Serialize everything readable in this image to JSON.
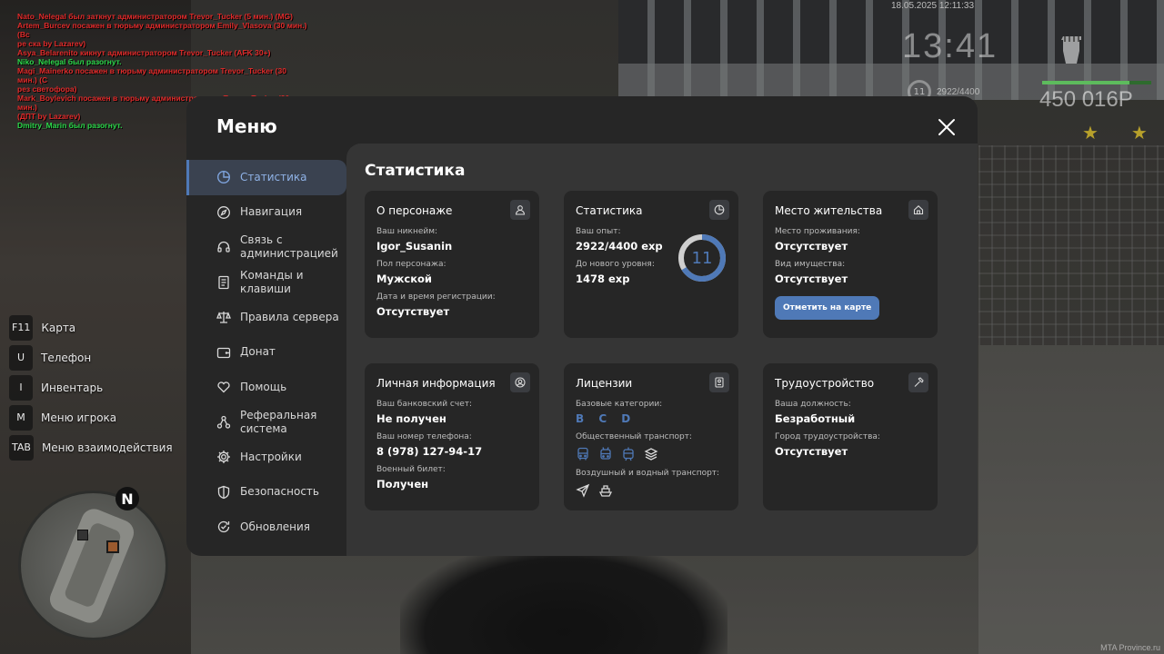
{
  "chat": [
    {
      "text": "Nato_Nelegal был заткнут администратором Trevor_Tucker (5 мин.) (MG)",
      "color": "red"
    },
    {
      "text": "Artem_Burcev посажен в тюрьму администратором Emily_Vlasova (30 мин.) (Вс",
      "color": "red"
    },
    {
      "text": "ре ска by Lazarev)",
      "color": "red"
    },
    {
      "text": "Asya_Belarenito кикнут администратором Trevor_Tucker (AFK 30+)",
      "color": "red"
    },
    {
      "text": "Niko_Nelegal был разогнут.",
      "color": "green"
    },
    {
      "text": "Magi_Mainerko посажен в тюрьму администратором Trevor_Tucker (30 мин.) (С",
      "color": "red"
    },
    {
      "text": "рез светофора)",
      "color": "red"
    },
    {
      "text": "Mark_Boylevich посажен в тюрьму администратором Trevor_Tucker (30 мин.)",
      "color": "red"
    },
    {
      "text": "(ДПТ by Lazarev)",
      "color": "red"
    },
    {
      "text": "Dmitry_Marin был разогнут.",
      "color": "green"
    }
  ],
  "hud": {
    "datetime": "18.05.2025 12:11:33",
    "clock": "13:41",
    "level": "11",
    "exp": "2922/4400",
    "money": "450 016Р",
    "health_fraction": 0.8,
    "stars": "★★"
  },
  "hotkeys": [
    {
      "key": "F11",
      "label": "Карта"
    },
    {
      "key": "U",
      "label": "Телефон"
    },
    {
      "key": "I",
      "label": "Инвентарь"
    },
    {
      "key": "M",
      "label": "Меню игрока"
    },
    {
      "key": "TAB",
      "label": "Меню взаимодействия"
    }
  ],
  "minimap": {
    "north": "N"
  },
  "watermark": "MTA Province.ru",
  "menu": {
    "title": "Меню",
    "sidebar": [
      {
        "label": "Статистика",
        "icon": "pie-chart-icon"
      },
      {
        "label": "Навигация",
        "icon": "compass-icon"
      },
      {
        "label": "Связь с администрацией",
        "icon": "headset-icon"
      },
      {
        "label": "Команды и клавиши",
        "icon": "document-icon"
      },
      {
        "label": "Правила сервера",
        "icon": "scales-icon"
      },
      {
        "label": "Донат",
        "icon": "wallet-icon"
      },
      {
        "label": "Помощь",
        "icon": "heart-hand-icon"
      },
      {
        "label": "Реферальная система",
        "icon": "network-icon"
      },
      {
        "label": "Настройки",
        "icon": "gear-icon"
      },
      {
        "label": "Безопасность",
        "icon": "shield-icon"
      },
      {
        "label": "Обновления",
        "icon": "refresh-check-icon"
      }
    ],
    "content_title": "Статистика",
    "cards": {
      "persona": {
        "title": "О персонаже",
        "nickname_label": "Ваш никнейм:",
        "nickname": "Igor_Susanin",
        "gender_label": "Пол персонажа:",
        "gender": "Мужской",
        "reg_label": "Дата и время регистрации:",
        "reg": "Отсутствует"
      },
      "stats": {
        "title": "Статистика",
        "exp_label": "Ваш опыт:",
        "exp": "2922/4400 exp",
        "next_label": "До нового уровня:",
        "next": "1478 exp",
        "level": "11",
        "progress_fraction": 0.664
      },
      "residence": {
        "title": "Место жительства",
        "place_label": "Место проживания:",
        "place": "Отсутствует",
        "property_label": "Вид имущества:",
        "property": "Отсутствует",
        "button": "Отметить на карте"
      },
      "personal": {
        "title": "Личная информация",
        "bank_label": "Ваш банковский счет:",
        "bank": "Не получен",
        "phone_label": "Ваш номер телефона:",
        "phone": "8 (978) 127-94-17",
        "military_label": "Военный билет:",
        "military": "Получен"
      },
      "licenses": {
        "title": "Лицензии",
        "base_label": "Базовые категории:",
        "base": "B C D",
        "public_label": "Общественный транспорт:",
        "air_label": "Воздушный и водный транспорт:"
      },
      "job": {
        "title": "Трудоустройство",
        "position_label": "Ваша должность:",
        "position": "Безработный",
        "city_label": "Город трудоустройства:",
        "city": "Отсутствует"
      }
    }
  },
  "colors": {
    "accent": "#4f79b7",
    "panel": "#262626",
    "content": "#353535",
    "card": "#262626"
  }
}
